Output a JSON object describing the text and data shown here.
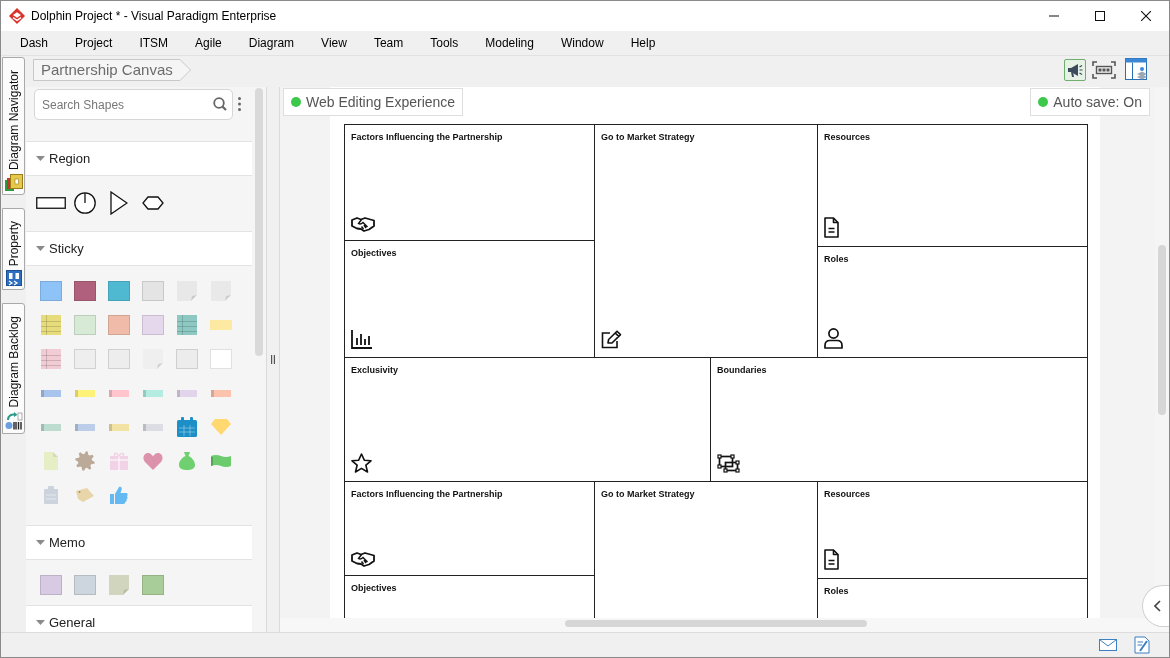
{
  "window": {
    "title": "Dolphin Project * - Visual Paradigm Enterprise"
  },
  "menu": [
    "Dash",
    "Project",
    "ITSM",
    "Agile",
    "Diagram",
    "View",
    "Team",
    "Tools",
    "Modeling",
    "Window",
    "Help"
  ],
  "side_tabs": [
    {
      "label": "Diagram Navigator",
      "kind": "navigator"
    },
    {
      "label": "Property",
      "kind": "property"
    },
    {
      "label": "Diagram Backlog",
      "kind": "backlog"
    }
  ],
  "breadcrumb": [
    "Partnership Canvas"
  ],
  "toolbar": [
    {
      "kind": "megaphone",
      "selected": true
    },
    {
      "kind": "frame",
      "selected": false
    },
    {
      "kind": "layout",
      "selected": false
    }
  ],
  "shape_panel": {
    "search": {
      "placeholder": "Search Shapes"
    },
    "sections": [
      {
        "title": "Region",
        "expanded": true,
        "shapes": [
          {
            "kind": "rectangle"
          },
          {
            "kind": "circle"
          },
          {
            "kind": "triangle"
          },
          {
            "kind": "hexagon"
          }
        ]
      },
      {
        "title": "Sticky",
        "expanded": true,
        "shapes": [
          {
            "kind": "note",
            "color": "#8ec3f8"
          },
          {
            "kind": "note",
            "color": "#b0607c"
          },
          {
            "kind": "note",
            "color": "#4fb9d2"
          },
          {
            "kind": "note",
            "color": "#e4e4e4"
          },
          {
            "kind": "curl",
            "color": "#e8e8e8"
          },
          {
            "kind": "curl",
            "color": "#e9e9e9"
          },
          {
            "kind": "lined",
            "color": "#e7dc7c"
          },
          {
            "kind": "note",
            "color": "#d6ead6"
          },
          {
            "kind": "note",
            "color": "#f0bba9"
          },
          {
            "kind": "note",
            "color": "#e5d8ec"
          },
          {
            "kind": "lined",
            "color": "#8ec8c2"
          },
          {
            "kind": "slip",
            "color": "#fde9a2"
          },
          {
            "kind": "lined",
            "color": "#f1ccd4"
          },
          {
            "kind": "note",
            "color": "#eeeeee"
          },
          {
            "kind": "note",
            "color": "#ededed"
          },
          {
            "kind": "curl",
            "color": "#efefef"
          },
          {
            "kind": "note",
            "color": "#ececec"
          },
          {
            "kind": "note",
            "color": "#ffffff"
          },
          {
            "kind": "tape",
            "color": "#a8c4ec"
          },
          {
            "kind": "tape",
            "color": "#fff27a"
          },
          {
            "kind": "tape",
            "color": "#ffc4cc"
          },
          {
            "kind": "tape",
            "color": "#b4ece2"
          },
          {
            "kind": "tape",
            "color": "#e2d4ea"
          },
          {
            "kind": "tape",
            "color": "#fbc3ad"
          },
          {
            "kind": "tape",
            "color": "#bcdcd0"
          },
          {
            "kind": "tape",
            "color": "#bccde9"
          },
          {
            "kind": "tape",
            "color": "#f2e2a4"
          },
          {
            "kind": "tape",
            "color": "#dcdce4"
          },
          {
            "kind": "calendar",
            "color": "#1d8fc7"
          },
          {
            "kind": "diamond",
            "color": "#ffd86f"
          },
          {
            "kind": "document",
            "color": "#e6eec6"
          },
          {
            "kind": "gear",
            "color": "#bcaa98"
          },
          {
            "kind": "gift",
            "color": "#f1d2e6"
          },
          {
            "kind": "heart",
            "color": "#dc92aa"
          },
          {
            "kind": "bag",
            "color": "#6fd06f"
          },
          {
            "kind": "banner",
            "color": "#6ccb6c"
          },
          {
            "kind": "clipboard",
            "color": "#ccd3dd"
          },
          {
            "kind": "tag",
            "color": "#e9d5aa"
          },
          {
            "kind": "thumb",
            "color": "#64b9f2"
          }
        ]
      },
      {
        "title": "Memo",
        "expanded": true,
        "shapes": [
          {
            "kind": "note",
            "color": "#d8cae3"
          },
          {
            "kind": "note",
            "color": "#cdd5de"
          },
          {
            "kind": "curl",
            "color": "#d1d5bd"
          },
          {
            "kind": "note",
            "color": "#a9cd98"
          }
        ]
      },
      {
        "title": "General",
        "expanded": true
      }
    ]
  },
  "canvas": {
    "badges": [
      "Web Editing Experience",
      "Auto save: On"
    ],
    "blocks": [
      {
        "kind": "triple",
        "columns": [
          [
            {
              "title": "Factors Influencing the Partnership",
              "kind": "handshake"
            },
            {
              "title": "Objectives",
              "kind": "chart"
            }
          ],
          [
            {
              "title": "Go to Market Strategy",
              "kind": "pencil"
            }
          ],
          [
            {
              "title": "Resources",
              "kind": "document"
            },
            {
              "title": "Roles",
              "kind": "person"
            }
          ]
        ]
      },
      {
        "kind": "double",
        "columns": [
          [
            {
              "title": "Exclusivity",
              "kind": "star"
            }
          ],
          [
            {
              "title": "Boundaries",
              "kind": "frames"
            }
          ]
        ]
      },
      {
        "kind": "triple",
        "columns": [
          [
            {
              "title": "Factors Influencing the Partnership",
              "kind": "handshake"
            },
            {
              "title": "Objectives"
            }
          ],
          [
            {
              "title": "Go to Market Strategy"
            }
          ],
          [
            {
              "title": "Resources",
              "kind": "document"
            },
            {
              "title": "Roles"
            }
          ]
        ]
      }
    ]
  }
}
